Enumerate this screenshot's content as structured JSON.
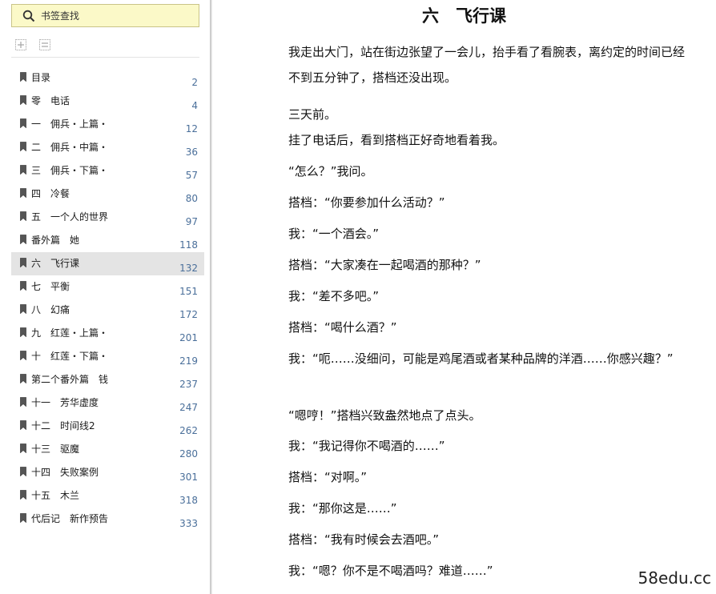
{
  "sidebar": {
    "search_placeholder": "书签查找",
    "toc": [
      {
        "label": "目录",
        "page": "2"
      },
      {
        "label": "零　电话",
        "page": "4"
      },
      {
        "label": "一　佣兵・上篇・",
        "page": "12"
      },
      {
        "label": "二　佣兵・中篇・",
        "page": "36"
      },
      {
        "label": "三　佣兵・下篇・",
        "page": "57"
      },
      {
        "label": "四　冷餐",
        "page": "80"
      },
      {
        "label": "五　一个人的世界",
        "page": "97"
      },
      {
        "label": "番外篇　她",
        "page": "118"
      },
      {
        "label": "六　飞行课",
        "page": "132",
        "selected": true
      },
      {
        "label": "七　平衡",
        "page": "151"
      },
      {
        "label": "八　幻痛",
        "page": "172"
      },
      {
        "label": "九　红莲・上篇・",
        "page": "201"
      },
      {
        "label": "十　红莲・下篇・",
        "page": "219"
      },
      {
        "label": "第二个番外篇　钱",
        "page": "237"
      },
      {
        "label": "十一　芳华虚度",
        "page": "247"
      },
      {
        "label": "十二　时间线2",
        "page": "262"
      },
      {
        "label": "十三　驱魔",
        "page": "280"
      },
      {
        "label": "十四　失败案例",
        "page": "301"
      },
      {
        "label": "十五　木兰",
        "page": "318"
      },
      {
        "label": "代后记　新作预告",
        "page": "333"
      }
    ]
  },
  "content": {
    "title": "六　飞行课",
    "paragraphs": [
      "我走出大门，站在街边张望了一会儿，抬手看了看腕表，离约定的时间已经不到五分钟了，搭档还没出现。",
      "三天前。",
      "挂了电话后，看到搭档正好奇地看着我。",
      "“怎么？”我问。",
      "搭档：“你要参加什么活动？”",
      "我：“一个酒会。”",
      "搭档：“大家凑在一起喝酒的那种？”",
      "我：“差不多吧。”",
      "搭档：“喝什么酒？”",
      "我：“呃……没细问，可能是鸡尾酒或者某种品牌的洋酒……你感兴趣？”",
      "“嗯哼！”搭档兴致盎然地点了点头。",
      "我：“我记得你不喝酒的……”",
      "搭档：“对啊。”",
      "我：“那你这是……”",
      "搭档：“我有时候会去酒吧。”",
      "我：“嗯？你不是不喝酒吗？难道……”"
    ]
  },
  "watermark": "58edu.cc",
  "icons": {
    "search": "search-icon",
    "expand_all": "expand-all-icon",
    "collapse_all": "collapse-all-icon",
    "bookmark": "bookmark-icon"
  }
}
